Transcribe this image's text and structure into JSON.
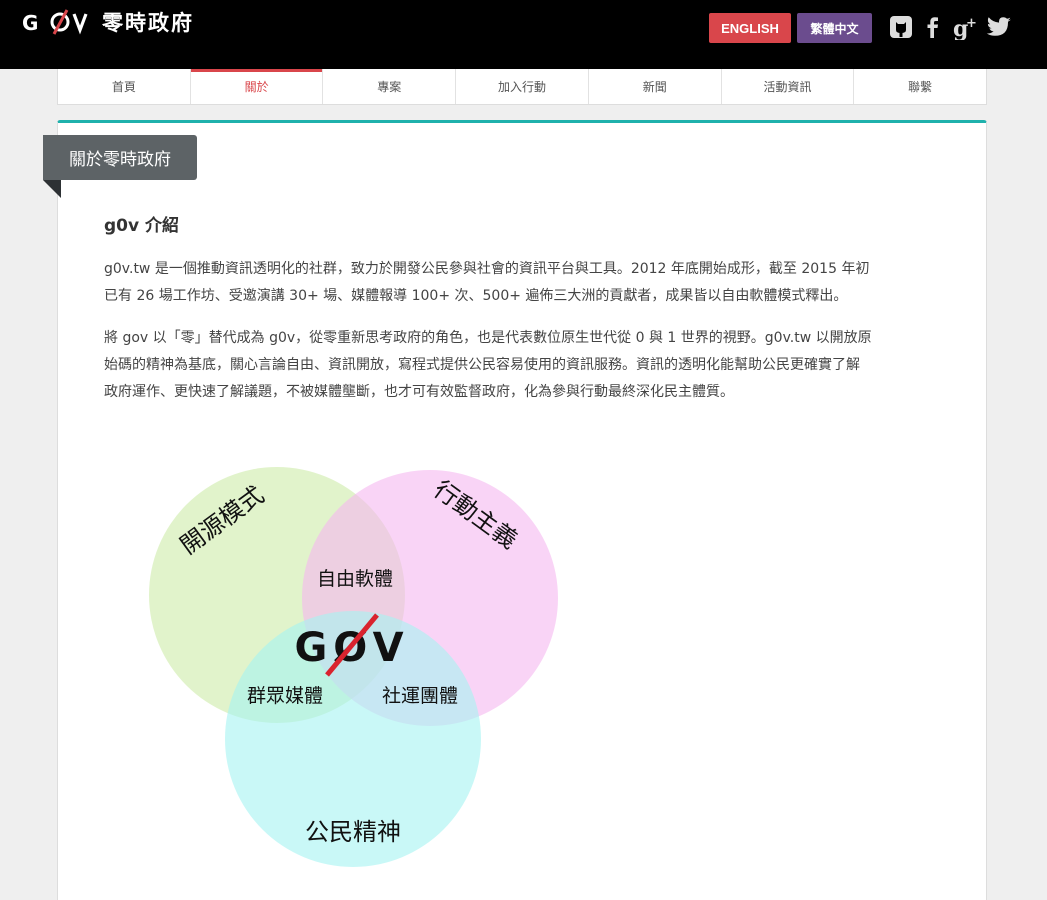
{
  "header": {
    "logo_text": "零時政府",
    "lang_english": "ENGLISH",
    "lang_chinese": "繁體中文",
    "social_icons": [
      "github-icon",
      "facebook-icon",
      "google-plus-icon",
      "twitter-icon"
    ]
  },
  "nav": {
    "items": [
      "首頁",
      "關於",
      "專案",
      "加入行動",
      "新聞",
      "活動資訊",
      "聯繫"
    ],
    "active": "關於"
  },
  "content": {
    "ribbon": "關於零時政府",
    "section_title": "g0v 介紹",
    "para1_line1": "g0v.tw 是一個推動資訊透明化的社群，致力於開發公民參與社會的資訊平台與工具。2012 年底開始成形，截至 2015 年初",
    "para1_line2": "已有 26 場工作坊、受邀演講 30+ 場、媒體報導 100+ 次、500+ 遍佈三大洲的貢獻者，成果皆以自由軟體模式釋出。",
    "para2_line1": "將 gov 以「零」替代成為 g0v，從零重新思考政府的角色，也是代表數位原生世代從 0 與 1 世界的視野。g0v.tw 以開放原",
    "para2_line2": "始碼的精神為基底，關心言論自由、資訊開放，寫程式提供公民容易使用的資訊服務。資訊的透明化能幫助公民更確實了解",
    "para2_line3": "政府運作、更快速了解議題，不被媒體壟斷，也才可有效監督政府，化為參與行動最終深化民主體質。"
  },
  "venn": {
    "open_source": "開源模式",
    "activism": "行動主義",
    "civic_spirit": "公民精神",
    "free_software": "自由軟體",
    "mass_media": "群眾媒體",
    "social_groups": "社運團體",
    "logo": "GØV"
  },
  "colors": {
    "header_bg": "#000000",
    "english_btn": "#d9464b",
    "chinese_btn": "#6b4c8e",
    "nav_active": "#d9464b",
    "card_accent": "#1fb1ac",
    "ribbon_bg": "#5d6366",
    "circle_open_source": "#d7efb9",
    "circle_activism": "#f5b7f0",
    "circle_civic": "#a5f3f2"
  }
}
